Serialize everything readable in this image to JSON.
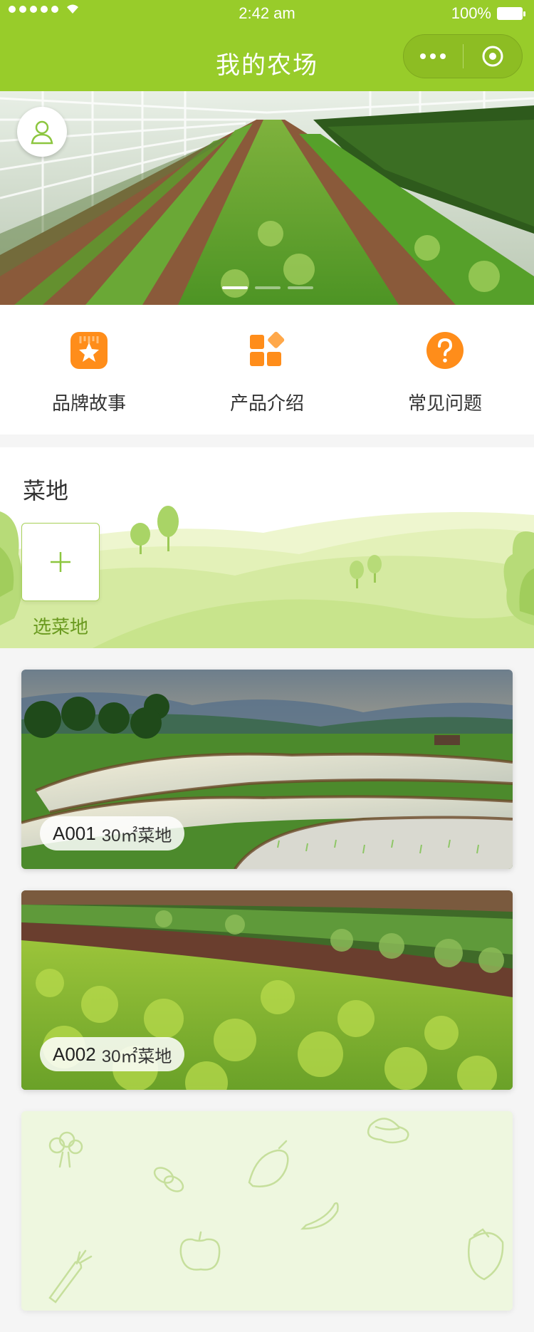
{
  "status_bar": {
    "time": "2:42 am",
    "battery": "100%"
  },
  "nav": {
    "title": "我的农场"
  },
  "quick_actions": [
    {
      "label": "品牌故事",
      "icon": "star-badge-icon"
    },
    {
      "label": "产品介绍",
      "icon": "apps-grid-icon"
    },
    {
      "label": "常见问题",
      "icon": "question-icon"
    }
  ],
  "plot_section": {
    "title": "菜地",
    "add_label": "选菜地"
  },
  "plots": [
    {
      "code": "A001",
      "desc": "30㎡菜地"
    },
    {
      "code": "A002",
      "desc": "30㎡菜地"
    }
  ],
  "colors": {
    "brand_green": "#98cc2a",
    "accent_orange": "#ff8d1a"
  }
}
